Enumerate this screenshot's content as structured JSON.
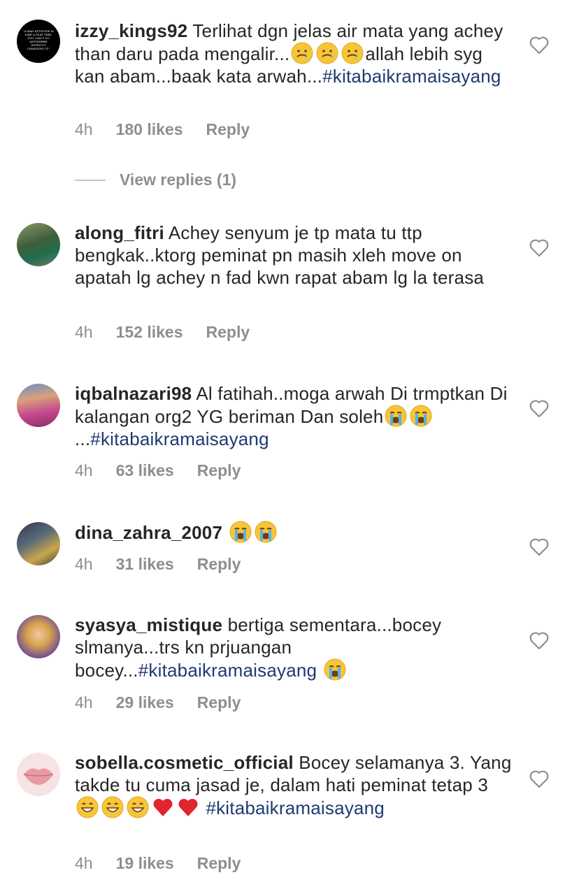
{
  "comments": [
    {
      "username": "izzy_kings92",
      "text": " Terlihat dgn jelas air mata yang achey than daru pada mengalir...",
      "text_after_emoji": "allah lebih syg kan abam...baak kata arwah...",
      "hashtag": "#kitabaikramaisayang",
      "time": "4h",
      "likes": "180 likes",
      "reply": "Reply",
      "avatar_text": "\"A BAD ATTITUDE IS LIKE A FLAT TIRE, YOU CAN'T GO ANYWHERE WITHOUT CHANGING IT.\""
    },
    {
      "username": "along_fitri",
      "text": " Achey senyum je tp mata tu ttp bengkak..ktorg peminat pn masih xleh move on apatah lg achey n fad kwn rapat abam lg la terasa",
      "time": "4h",
      "likes": "152 likes",
      "reply": "Reply"
    },
    {
      "username": "iqbalnazari98",
      "text": " Al fatihah..moga arwah Di trmptkan  Di kalangan org2 YG beriman Dan soleh",
      "text_after_emoji": " ...",
      "hashtag": "#kitabaikramaisayang",
      "time": "4h",
      "likes": "63 likes",
      "reply": "Reply"
    },
    {
      "username": "dina_zahra_2007",
      "text": " ",
      "time": "4h",
      "likes": "31 likes",
      "reply": "Reply"
    },
    {
      "username": "syasya_mistique",
      "text": " bertiga sementara...bocey slmanya...trs kn prjuangan bocey...",
      "hashtag": "#kitabaikramaisayang",
      "time": "4h",
      "likes": "29 likes",
      "reply": "Reply"
    },
    {
      "username": "sobella.cosmetic_official",
      "text": " Bocey selamanya 3. Yang takde tu cuma jasad je, dalam hati peminat tetap 3",
      "hashtag": "#kitabaikramaisayang",
      "time": "4h",
      "likes": "19 likes",
      "reply": "Reply"
    }
  ],
  "view_replies": "View replies (1)",
  "colors": {
    "hashtag": "#1e3a72",
    "meta_gray": "#8e8e8e"
  },
  "icons": [
    "heart-icon",
    "crying-face-emoji",
    "loudly-crying-face-emoji",
    "grinning-face-emoji",
    "red-heart-emoji"
  ]
}
